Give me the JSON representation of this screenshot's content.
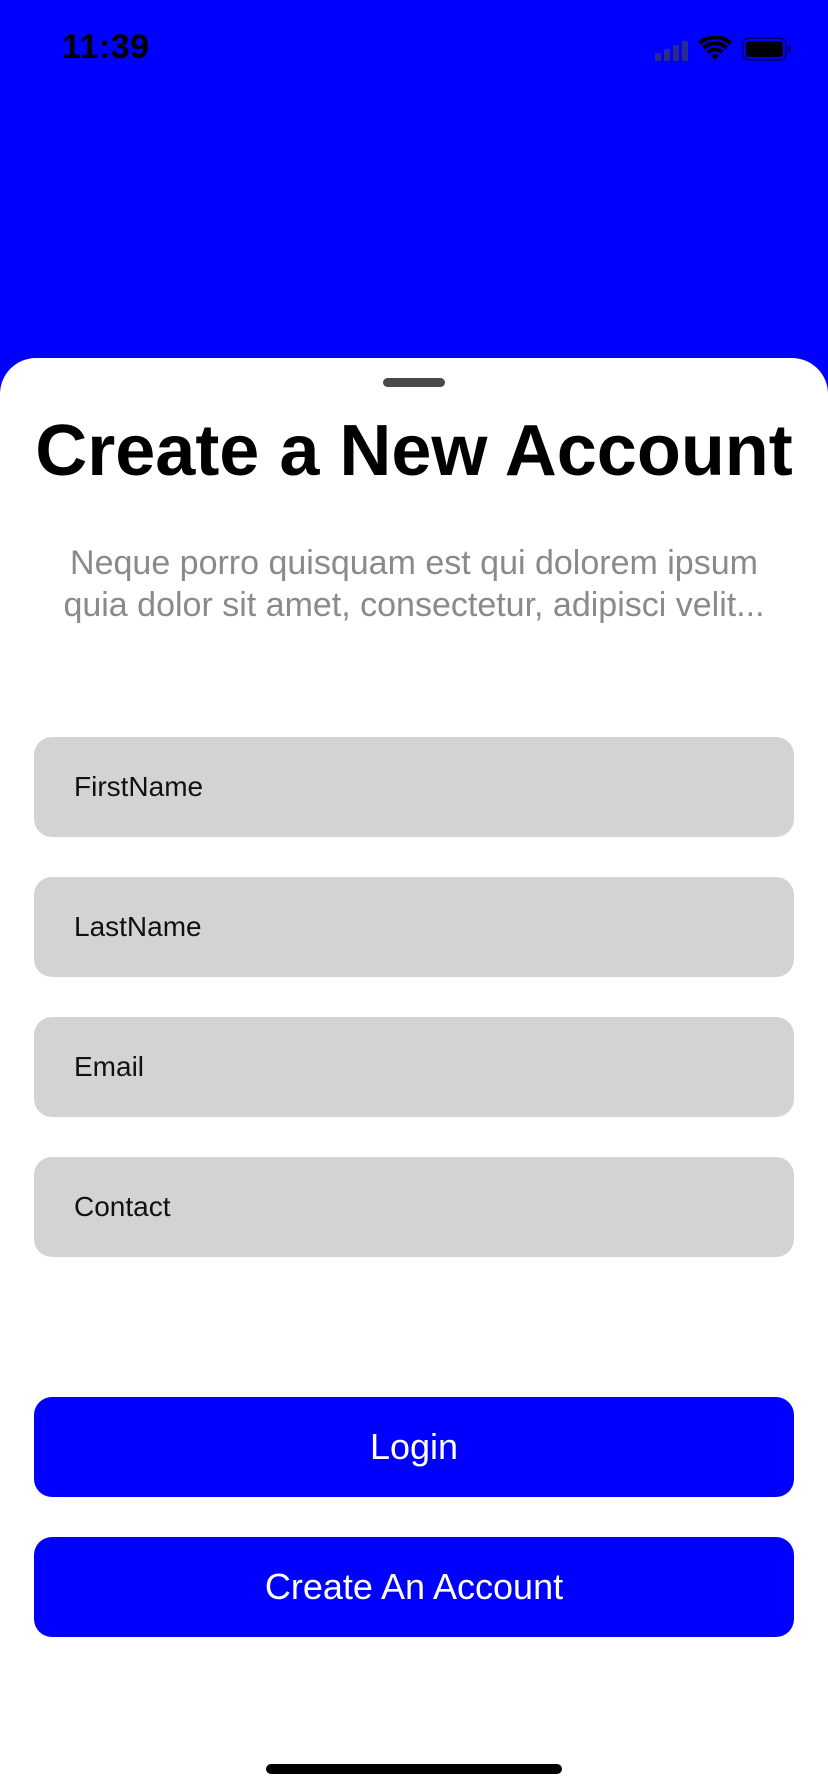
{
  "status_bar": {
    "time": "11:39",
    "icons": [
      "cellular-signal-icon",
      "wifi-icon",
      "battery-icon"
    ]
  },
  "colors": {
    "accent": "#0000FF",
    "field_background": "#D3D3D3",
    "subtitle_text": "#8A8A8A"
  },
  "sheet": {
    "title": "Create a New Account",
    "subtitle": "Neque porro quisquam est qui dolorem ipsum quia dolor sit amet, consectetur, adipisci velit...",
    "fields": {
      "first_name": {
        "placeholder": "FirstName",
        "value": ""
      },
      "last_name": {
        "placeholder": "LastName",
        "value": ""
      },
      "email": {
        "placeholder": "Email",
        "value": ""
      },
      "contact": {
        "placeholder": "Contact",
        "value": ""
      }
    },
    "buttons": {
      "login": "Login",
      "create_account": "Create An Account"
    }
  }
}
